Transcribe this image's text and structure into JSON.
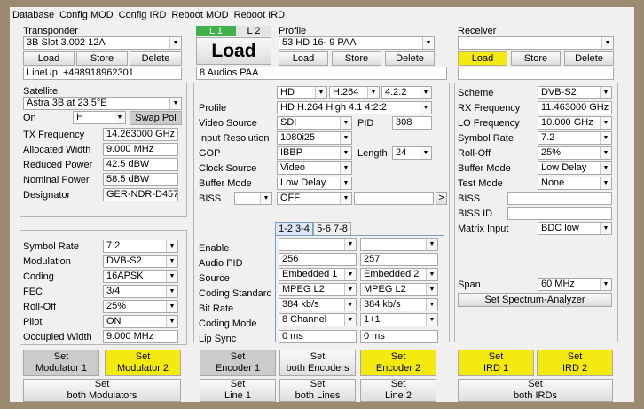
{
  "menu": [
    "Database",
    "Config MOD",
    "Config IRD",
    "Reboot MOD",
    "Reboot IRD"
  ],
  "transponder": {
    "label": "Transponder",
    "value": "3B Slot 3.002 12A",
    "load": "Load",
    "store": "Store",
    "delete": "Delete",
    "lineup": "LineUp: +498918962301"
  },
  "satellite": {
    "label": "Satellite",
    "value": "Astra 3B at 23.5°E",
    "on_label": "On",
    "on_value": "H",
    "swap": "Swap Pol",
    "rows": [
      {
        "label": "TX Frequency",
        "value": "14.263000 GHz"
      },
      {
        "label": "Allocated Width",
        "value": "9.000 MHz"
      },
      {
        "label": "Reduced Power",
        "value": "42.5 dBW"
      },
      {
        "label": "Nominal Power",
        "value": "58.5 dBW"
      },
      {
        "label": "Designator",
        "value": "GER-NDR-D457"
      }
    ]
  },
  "modulator": {
    "rows": [
      {
        "label": "Symbol Rate",
        "value": "7.2"
      },
      {
        "label": "Modulation",
        "value": "DVB-S2"
      },
      {
        "label": "Coding",
        "value": "16APSK"
      },
      {
        "label": "FEC",
        "value": "3/4"
      },
      {
        "label": "Roll-Off",
        "value": "25%"
      },
      {
        "label": "Pilot",
        "value": "ON"
      }
    ],
    "occ_label": "Occupied Width",
    "occ_value": "9.000 MHz"
  },
  "lines": {
    "l1": "L 1",
    "l2": "L 2",
    "load_big": "Load"
  },
  "profile": {
    "label": "Profile",
    "value": "53  HD 16- 9   PAA",
    "load": "Load",
    "store": "Store",
    "delete": "Delete",
    "audios": "8 Audios PAA"
  },
  "encoder": {
    "fmt": "HD",
    "codec": "H.264",
    "chroma": "4:2:2",
    "profile_label": "Profile",
    "profile_value": "HD H.264 High 4.1 4:2:2",
    "video_source_label": "Video Source",
    "video_source": "SDI",
    "pid_label": "PID",
    "pid": "308",
    "input_res_label": "Input Resolution",
    "input_res": "1080i25",
    "gop_label": "GOP",
    "gop": "IBBP",
    "length_label": "Length",
    "length": "24",
    "clock_label": "Clock Source",
    "clock": "Video",
    "buffer_label": "Buffer Mode",
    "buffer": "Low Delay",
    "biss_label": "BISS",
    "biss_off": "OFF",
    "biss_go": ">"
  },
  "audio": {
    "tab1": "1-2 3-4",
    "tab2": "5-6 7-8",
    "labels": [
      "Enable",
      "Audio PID",
      "Source",
      "Coding Standard",
      "Bit Rate",
      "Coding Mode",
      "Lip Sync"
    ],
    "col1": {
      "pid": "256",
      "source": "Embedded 1",
      "coding": "MPEG L2",
      "bitrate": "384 kb/s",
      "mode": "8 Channel",
      "lipsync": "0 ms"
    },
    "col2": {
      "pid": "257",
      "source": "Embedded 2",
      "coding": "MPEG L2",
      "bitrate": "384 kb/s",
      "mode": "1+1",
      "lipsync": "0 ms"
    }
  },
  "receiver": {
    "label": "Receiver",
    "load": "Load",
    "store": "Store",
    "delete": "Delete",
    "rows": [
      {
        "label": "Scheme",
        "value": "DVB-S2"
      },
      {
        "label": "RX Frequency",
        "value": "11.463000 GHz"
      },
      {
        "label": "LO Frequency",
        "value": "10.000 GHz"
      },
      {
        "label": "Symbol Rate",
        "value": "7.2"
      },
      {
        "label": "Roll-Off",
        "value": "25%"
      },
      {
        "label": "Buffer Mode",
        "value": "Low Delay"
      },
      {
        "label": "Test Mode",
        "value": "None"
      }
    ],
    "biss_label": "BISS",
    "biss_id_label": "BISS ID",
    "matrix_label": "Matrix Input",
    "matrix_value": "BDC low",
    "span_label": "Span",
    "span_value": "60 MHz",
    "spectrum_btn": "Set Spectrum-Analyzer"
  },
  "buttons": {
    "mod1": [
      "Set",
      "Modulator 1"
    ],
    "mod2": [
      "Set",
      "Modulator 2"
    ],
    "enc1": [
      "Set",
      "Encoder 1"
    ],
    "encboth": [
      "Set",
      "both Encoders"
    ],
    "enc2": [
      "Set",
      "Encoder 2"
    ],
    "ird1": [
      "Set",
      "IRD 1"
    ],
    "ird2": [
      "Set",
      "IRD 2"
    ],
    "modboth": [
      "Set",
      "both Modulators"
    ],
    "line1": [
      "Set",
      "Line 1"
    ],
    "lineboth": [
      "Set",
      "both Lines"
    ],
    "line2": [
      "Set",
      "Line 2"
    ],
    "irdboth": [
      "Set",
      "both IRDs"
    ]
  },
  "colors": {
    "yellow": "#f5ea10",
    "line_active": "#3fb04a",
    "bg": "#f0f0f0"
  }
}
